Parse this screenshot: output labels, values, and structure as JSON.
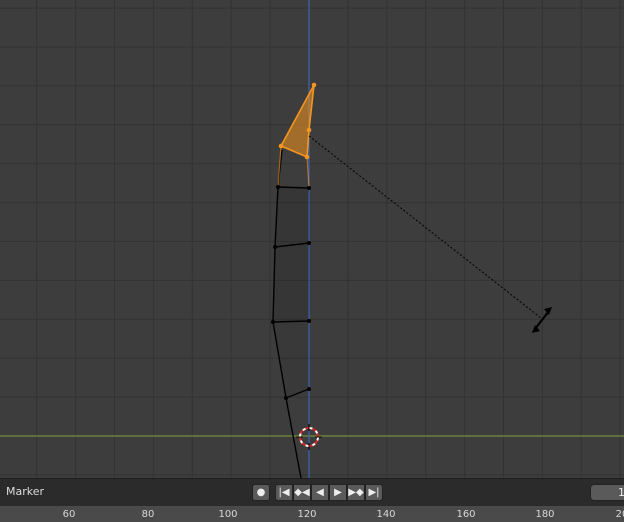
{
  "timeline": {
    "marker_label": "Marker",
    "current_frame": "1",
    "ruler_ticks": [
      "60",
      "80",
      "100",
      "120",
      "140",
      "160",
      "180",
      "20"
    ]
  },
  "transport": {
    "record_icon": "record-icon",
    "buttons": [
      "jump-start-icon",
      "prev-keyframe-icon",
      "play-reverse-icon",
      "play-icon",
      "next-keyframe-icon",
      "jump-end-icon"
    ]
  },
  "colors": {
    "grid_background": "#3d3d3d",
    "grid_line": "#333333",
    "x_axis": "#7fa33a",
    "z_axis": "#3e64b3",
    "selection": "#f5951e",
    "mesh_edge": "#000000"
  }
}
